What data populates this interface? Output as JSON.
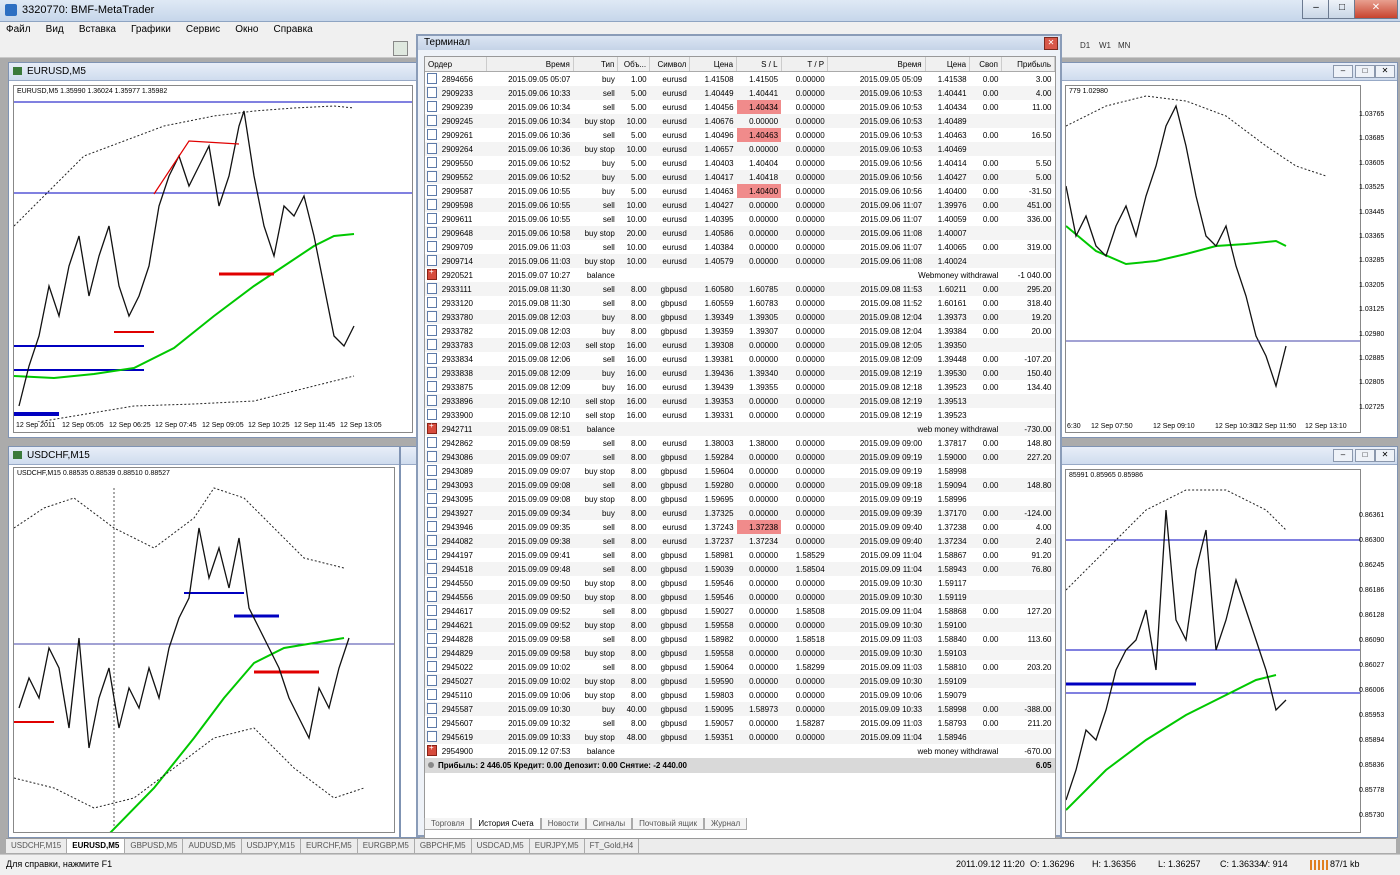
{
  "app": {
    "title": "3320770: BMF-MetaTrader",
    "menu": [
      "Файл",
      "Вид",
      "Вставка",
      "Графики",
      "Сервис",
      "Окно",
      "Справка"
    ],
    "timeframes": [
      "D1",
      "W1",
      "MN"
    ]
  },
  "charts": {
    "eurusd": {
      "title": "EURUSD,M5",
      "info": "EURUSD,M5  1.35990 1.36024 1.35977 1.35982",
      "times": [
        "12 Sep 2011",
        "12 Sep 05:05",
        "12 Sep 06:25",
        "12 Sep 07:45",
        "12 Sep 09:05",
        "12 Sep 10:25",
        "12 Sep 11:45",
        "12 Sep 13:05"
      ]
    },
    "usdchf": {
      "title": "USDCHF,M15",
      "info": "USDCHF,M15  0.88535 0.88539 0.88510 0.88527"
    },
    "right_top": {
      "info": "779 1.02980",
      "prices": [
        "1.03765",
        "1.03685",
        "1.03605",
        "1.03525",
        "1.03445",
        "1.03365",
        "1.03285",
        "1.03205",
        "1.03125",
        "1.02980",
        "1.02885",
        "1.02805",
        "1.02725"
      ],
      "times": [
        "6:30",
        "12 Sep 07:50",
        "12 Sep 09:10",
        "12 Sep 10:30",
        "12 Sep 11:50",
        "12 Sep 13:10"
      ]
    },
    "right_bottom": {
      "info": "85991 0.85965 0.85986",
      "prices": [
        "0.86361",
        "0.86300",
        "0.86245",
        "0.86186",
        "0.86128",
        "0.86090",
        "0.86027",
        "0.86006",
        "0.85953",
        "0.85894",
        "0.85836",
        "0.85778",
        "0.85730"
      ]
    }
  },
  "terminal": {
    "title": "Терминал",
    "columns": [
      "Ордер",
      "Время",
      "Тип",
      "Объ...",
      "Символ",
      "Цена",
      "S / L",
      "T / P",
      "Время",
      "Цена",
      "Своп",
      "Прибыль"
    ],
    "rows": [
      [
        "2894656",
        "2015.09.05 05:07",
        "buy",
        "1.00",
        "eurusd",
        "1.41508",
        "1.41505",
        "0.00000",
        "2015.09.05 05:09",
        "1.41538",
        "0.00",
        "3.00"
      ],
      [
        "2909233",
        "2015.09.06 10:33",
        "sell",
        "5.00",
        "eurusd",
        "1.40449",
        "1.40441",
        "0.00000",
        "2015.09.06 10:53",
        "1.40441",
        "0.00",
        "4.00"
      ],
      [
        "2909239",
        "2015.09.06 10:34",
        "sell",
        "5.00",
        "eurusd",
        "1.40456",
        "1.40434",
        "0.00000",
        "2015.09.06 10:53",
        "1.40434",
        "0.00",
        "11.00"
      ],
      [
        "2909245",
        "2015.09.06 10:34",
        "buy stop",
        "10.00",
        "eurusd",
        "1.40676",
        "0.00000",
        "0.00000",
        "2015.09.06 10:53",
        "1.40489",
        "",
        ""
      ],
      [
        "2909261",
        "2015.09.06 10:36",
        "sell",
        "5.00",
        "eurusd",
        "1.40496",
        "1.40463",
        "0.00000",
        "2015.09.06 10:53",
        "1.40463",
        "0.00",
        "16.50"
      ],
      [
        "2909264",
        "2015.09.06 10:36",
        "buy stop",
        "10.00",
        "eurusd",
        "1.40657",
        "0.00000",
        "0.00000",
        "2015.09.06 10:53",
        "1.40469",
        "",
        ""
      ],
      [
        "2909550",
        "2015.09.06 10:52",
        "buy",
        "5.00",
        "eurusd",
        "1.40403",
        "1.40404",
        "0.00000",
        "2015.09.06 10:56",
        "1.40414",
        "0.00",
        "5.50"
      ],
      [
        "2909552",
        "2015.09.06 10:52",
        "buy",
        "5.00",
        "eurusd",
        "1.40417",
        "1.40418",
        "0.00000",
        "2015.09.06 10:56",
        "1.40427",
        "0.00",
        "5.00"
      ],
      [
        "2909587",
        "2015.09.06 10:55",
        "buy",
        "5.00",
        "eurusd",
        "1.40463",
        "1.40400",
        "0.00000",
        "2015.09.06 10:56",
        "1.40400",
        "0.00",
        "-31.50"
      ],
      [
        "2909598",
        "2015.09.06 10:55",
        "sell",
        "10.00",
        "eurusd",
        "1.40427",
        "0.00000",
        "0.00000",
        "2015.09.06 11:07",
        "1.39976",
        "0.00",
        "451.00"
      ],
      [
        "2909611",
        "2015.09.06 10:55",
        "sell",
        "10.00",
        "eurusd",
        "1.40395",
        "0.00000",
        "0.00000",
        "2015.09.06 11:07",
        "1.40059",
        "0.00",
        "336.00"
      ],
      [
        "2909648",
        "2015.09.06 10:58",
        "buy stop",
        "20.00",
        "eurusd",
        "1.40586",
        "0.00000",
        "0.00000",
        "2015.09.06 11:08",
        "1.40007",
        "",
        ""
      ],
      [
        "2909709",
        "2015.09.06 11:03",
        "sell",
        "10.00",
        "eurusd",
        "1.40384",
        "0.00000",
        "0.00000",
        "2015.09.06 11:07",
        "1.40065",
        "0.00",
        "319.00"
      ],
      [
        "2909714",
        "2015.09.06 11:03",
        "buy stop",
        "10.00",
        "eurusd",
        "1.40579",
        "0.00000",
        "0.00000",
        "2015.09.06 11:08",
        "1.40024",
        "",
        ""
      ],
      [
        "2920521",
        "2015.09.07 10:27",
        "balance",
        "",
        "",
        "",
        "",
        "",
        "Webmoney withdrawal",
        "",
        "",
        "-1 040.00"
      ],
      [
        "2933111",
        "2015.09.08 11:30",
        "sell",
        "8.00",
        "gbpusd",
        "1.60580",
        "1.60785",
        "0.00000",
        "2015.09.08 11:53",
        "1.60211",
        "0.00",
        "295.20"
      ],
      [
        "2933120",
        "2015.09.08 11:30",
        "sell",
        "8.00",
        "gbpusd",
        "1.60559",
        "1.60783",
        "0.00000",
        "2015.09.08 11:52",
        "1.60161",
        "0.00",
        "318.40"
      ],
      [
        "2933780",
        "2015.09.08 12:03",
        "buy",
        "8.00",
        "gbpusd",
        "1.39349",
        "1.39305",
        "0.00000",
        "2015.09.08 12:04",
        "1.39373",
        "0.00",
        "19.20"
      ],
      [
        "2933782",
        "2015.09.08 12:03",
        "buy",
        "8.00",
        "gbpusd",
        "1.39359",
        "1.39307",
        "0.00000",
        "2015.09.08 12:04",
        "1.39384",
        "0.00",
        "20.00"
      ],
      [
        "2933783",
        "2015.09.08 12:03",
        "sell stop",
        "16.00",
        "eurusd",
        "1.39308",
        "0.00000",
        "0.00000",
        "2015.09.08 12:05",
        "1.39350",
        "",
        ""
      ],
      [
        "2933834",
        "2015.09.08 12:06",
        "sell",
        "16.00",
        "eurusd",
        "1.39381",
        "0.00000",
        "0.00000",
        "2015.09.08 12:09",
        "1.39448",
        "0.00",
        "-107.20"
      ],
      [
        "2933838",
        "2015.09.08 12:09",
        "buy",
        "16.00",
        "eurusd",
        "1.39436",
        "1.39340",
        "0.00000",
        "2015.09.08 12:19",
        "1.39530",
        "0.00",
        "150.40"
      ],
      [
        "2933875",
        "2015.09.08 12:09",
        "buy",
        "16.00",
        "eurusd",
        "1.39439",
        "1.39355",
        "0.00000",
        "2015.09.08 12:18",
        "1.39523",
        "0.00",
        "134.40"
      ],
      [
        "2933896",
        "2015.09.08 12:10",
        "sell stop",
        "16.00",
        "eurusd",
        "1.39353",
        "0.00000",
        "0.00000",
        "2015.09.08 12:19",
        "1.39513",
        "",
        ""
      ],
      [
        "2933900",
        "2015.09.08 12:10",
        "sell stop",
        "16.00",
        "eurusd",
        "1.39331",
        "0.00000",
        "0.00000",
        "2015.09.08 12:19",
        "1.39523",
        "",
        ""
      ],
      [
        "2942711",
        "2015.09.09 08:51",
        "balance",
        "",
        "",
        "",
        "",
        "",
        "web money withdrawal",
        "",
        "",
        "-730.00"
      ],
      [
        "2942862",
        "2015.09.09 08:59",
        "sell",
        "8.00",
        "eurusd",
        "1.38003",
        "1.38000",
        "0.00000",
        "2015.09.09 09:00",
        "1.37817",
        "0.00",
        "148.80"
      ],
      [
        "2943086",
        "2015.09.09 09:07",
        "sell",
        "8.00",
        "gbpusd",
        "1.59284",
        "0.00000",
        "0.00000",
        "2015.09.09 09:19",
        "1.59000",
        "0.00",
        "227.20"
      ],
      [
        "2943089",
        "2015.09.09 09:07",
        "buy stop",
        "8.00",
        "gbpusd",
        "1.59604",
        "0.00000",
        "0.00000",
        "2015.09.09 09:19",
        "1.58998",
        "",
        ""
      ],
      [
        "2943093",
        "2015.09.09 09:08",
        "sell",
        "8.00",
        "gbpusd",
        "1.59280",
        "0.00000",
        "0.00000",
        "2015.09.09 09:18",
        "1.59094",
        "0.00",
        "148.80"
      ],
      [
        "2943095",
        "2015.09.09 09:08",
        "buy stop",
        "8.00",
        "gbpusd",
        "1.59695",
        "0.00000",
        "0.00000",
        "2015.09.09 09:19",
        "1.58996",
        "",
        ""
      ],
      [
        "2943927",
        "2015.09.09 09:34",
        "buy",
        "8.00",
        "eurusd",
        "1.37325",
        "0.00000",
        "0.00000",
        "2015.09.09 09:39",
        "1.37170",
        "0.00",
        "-124.00"
      ],
      [
        "2943946",
        "2015.09.09 09:35",
        "sell",
        "8.00",
        "eurusd",
        "1.37243",
        "1.37238",
        "0.00000",
        "2015.09.09 09:40",
        "1.37238",
        "0.00",
        "4.00"
      ],
      [
        "2944082",
        "2015.09.09 09:38",
        "sell",
        "8.00",
        "eurusd",
        "1.37237",
        "1.37234",
        "0.00000",
        "2015.09.09 09:40",
        "1.37234",
        "0.00",
        "2.40"
      ],
      [
        "2944197",
        "2015.09.09 09:41",
        "sell",
        "8.00",
        "gbpusd",
        "1.58981",
        "0.00000",
        "1.58529",
        "2015.09.09 11:04",
        "1.58867",
        "0.00",
        "91.20"
      ],
      [
        "2944518",
        "2015.09.09 09:48",
        "sell",
        "8.00",
        "gbpusd",
        "1.59039",
        "0.00000",
        "1.58504",
        "2015.09.09 11:04",
        "1.58943",
        "0.00",
        "76.80"
      ],
      [
        "2944550",
        "2015.09.09 09:50",
        "buy stop",
        "8.00",
        "gbpusd",
        "1.59546",
        "0.00000",
        "0.00000",
        "2015.09.09 10:30",
        "1.59117",
        "",
        ""
      ],
      [
        "2944556",
        "2015.09.09 09:50",
        "buy stop",
        "8.00",
        "gbpusd",
        "1.59546",
        "0.00000",
        "0.00000",
        "2015.09.09 10:30",
        "1.59119",
        "",
        ""
      ],
      [
        "2944617",
        "2015.09.09 09:52",
        "sell",
        "8.00",
        "gbpusd",
        "1.59027",
        "0.00000",
        "1.58508",
        "2015.09.09 11:04",
        "1.58868",
        "0.00",
        "127.20"
      ],
      [
        "2944621",
        "2015.09.09 09:52",
        "buy stop",
        "8.00",
        "gbpusd",
        "1.59558",
        "0.00000",
        "0.00000",
        "2015.09.09 10:30",
        "1.59100",
        "",
        ""
      ],
      [
        "2944828",
        "2015.09.09 09:58",
        "sell",
        "8.00",
        "gbpusd",
        "1.58982",
        "0.00000",
        "1.58518",
        "2015.09.09 11:03",
        "1.58840",
        "0.00",
        "113.60"
      ],
      [
        "2944829",
        "2015.09.09 09:58",
        "buy stop",
        "8.00",
        "gbpusd",
        "1.59558",
        "0.00000",
        "0.00000",
        "2015.09.09 10:30",
        "1.59103",
        "",
        ""
      ],
      [
        "2945022",
        "2015.09.09 10:02",
        "sell",
        "8.00",
        "gbpusd",
        "1.59064",
        "0.00000",
        "1.58299",
        "2015.09.09 11:03",
        "1.58810",
        "0.00",
        "203.20"
      ],
      [
        "2945027",
        "2015.09.09 10:02",
        "buy stop",
        "8.00",
        "gbpusd",
        "1.59590",
        "0.00000",
        "0.00000",
        "2015.09.09 10:30",
        "1.59109",
        "",
        ""
      ],
      [
        "2945110",
        "2015.09.09 10:06",
        "buy stop",
        "8.00",
        "gbpusd",
        "1.59803",
        "0.00000",
        "0.00000",
        "2015.09.09 10:06",
        "1.59079",
        "",
        ""
      ],
      [
        "2945587",
        "2015.09.09 10:30",
        "buy",
        "40.00",
        "gbpusd",
        "1.59095",
        "1.58973",
        "0.00000",
        "2015.09.09 10:33",
        "1.58998",
        "0.00",
        "-388.00"
      ],
      [
        "2945607",
        "2015.09.09 10:32",
        "sell",
        "8.00",
        "gbpusd",
        "1.59057",
        "0.00000",
        "1.58287",
        "2015.09.09 11:03",
        "1.58793",
        "0.00",
        "211.20"
      ],
      [
        "2945619",
        "2015.09.09 10:33",
        "buy stop",
        "48.00",
        "gbpusd",
        "1.59351",
        "0.00000",
        "0.00000",
        "2015.09.09 11:04",
        "1.58946",
        "",
        ""
      ],
      [
        "2954900",
        "2015.09.12 07:53",
        "balance",
        "",
        "",
        "",
        "",
        "",
        "web money withdrawal",
        "",
        "",
        "-670.00"
      ]
    ],
    "highlight_cells": [
      [
        1,
        6
      ],
      [
        2,
        6
      ],
      [
        4,
        6
      ],
      [
        8,
        6
      ],
      [
        32,
        6
      ],
      [
        33,
        6
      ]
    ],
    "summary": "Прибыль: 2 446.05  Кредит: 0.00  Депозит: 0.00  Снятие: -2 440.00",
    "summary_total": "6.05",
    "tabs": [
      "Торговля",
      "История Счета",
      "Новости",
      "Сигналы",
      "Почтовый ящик",
      "Журнал"
    ],
    "active_tab": "История Счета"
  },
  "window_tabs": [
    "USDCHF,M15",
    "EURUSD,M5",
    "GBPUSD,M5",
    "AUDUSD,M5",
    "USDJPY,M15",
    "EURCHF,M5",
    "EURGBP,M5",
    "GBPCHF,M5",
    "USDCAD,M5",
    "EURJPY,M5",
    "FT_Gold,H4"
  ],
  "active_window_tab": "EURUSD,M5",
  "status": {
    "help": "Для справки, нажмите F1",
    "datetime": "2011.09.12 11:20",
    "open": "O: 1.36296",
    "high": "H: 1.36356",
    "low": "L: 1.36257",
    "close": "C: 1.36334",
    "volume": "V: 914",
    "traffic": "87/1 kb"
  },
  "colors": {
    "highlight": "#f08b8b",
    "ma_line": "#00c800",
    "level_line": "#0000c0",
    "sl_line": "#e00000"
  }
}
